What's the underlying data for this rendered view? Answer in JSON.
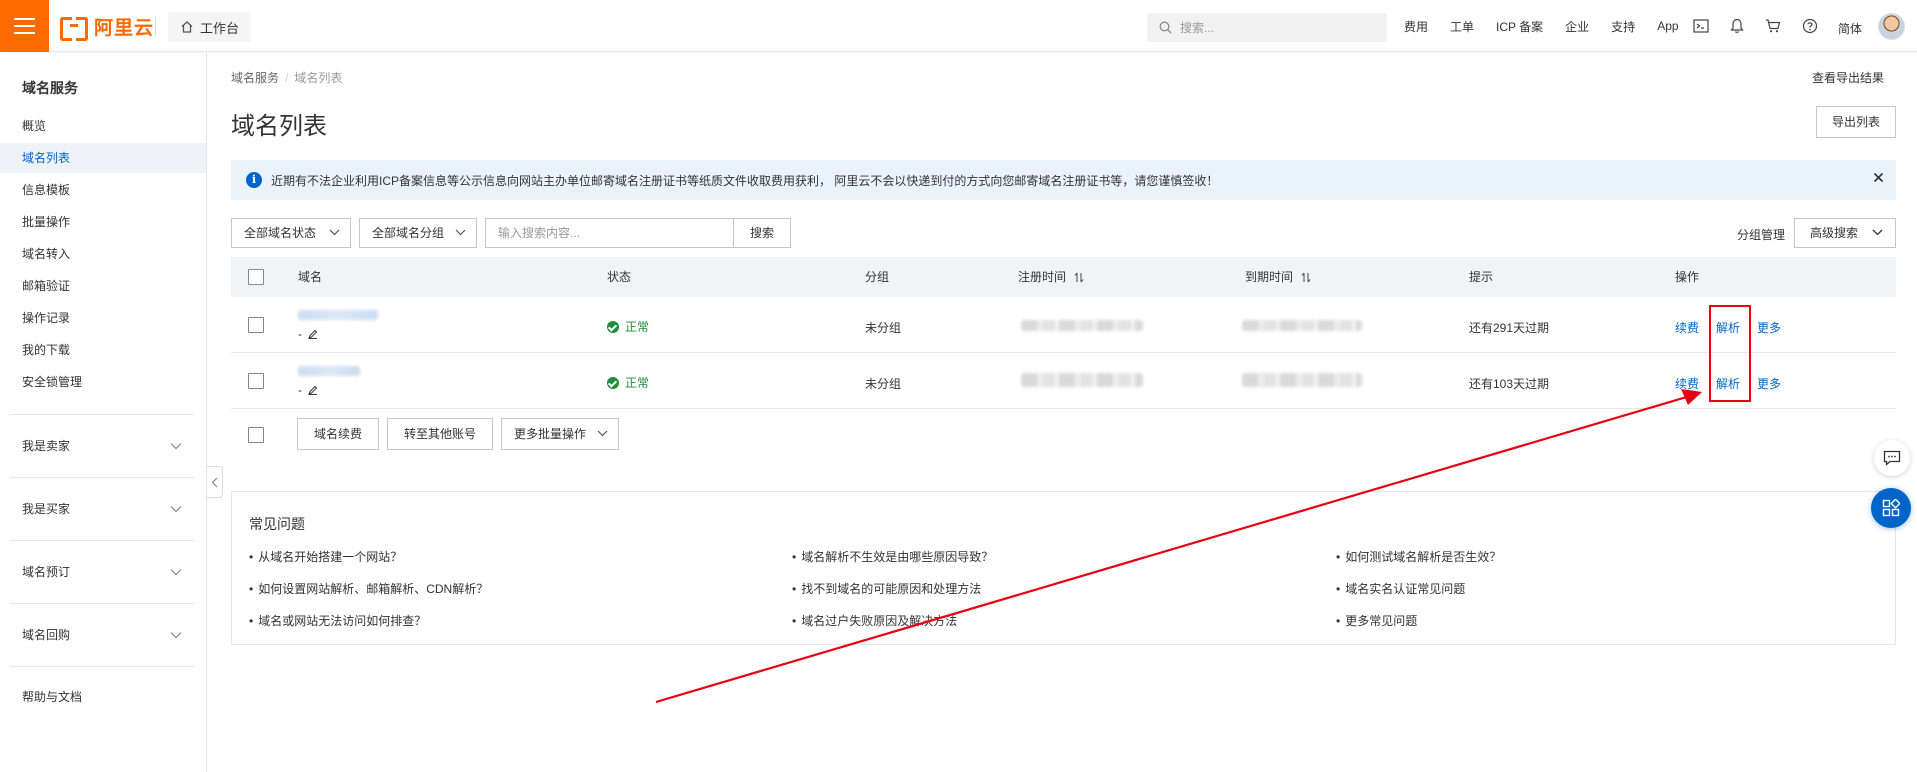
{
  "topbar": {
    "brand": "阿里云",
    "workbench": "工作台",
    "search_placeholder": "搜索...",
    "nav": [
      "费用",
      "工单",
      "ICP 备案",
      "企业",
      "支持",
      "App"
    ],
    "language": "简体"
  },
  "sidebar": {
    "title": "域名服务",
    "items": [
      {
        "label": "概览",
        "active": false
      },
      {
        "label": "域名列表",
        "active": true
      },
      {
        "label": "信息模板",
        "active": false
      },
      {
        "label": "批量操作",
        "active": false
      },
      {
        "label": "域名转入",
        "active": false
      },
      {
        "label": "邮箱验证",
        "active": false
      },
      {
        "label": "操作记录",
        "active": false
      },
      {
        "label": "我的下载",
        "active": false
      },
      {
        "label": "安全锁管理",
        "active": false
      }
    ],
    "groups": [
      "我是卖家",
      "我是买家",
      "域名预订",
      "域名回购"
    ],
    "help": "帮助与文档"
  },
  "breadcrumb": {
    "root": "域名服务",
    "current": "域名列表"
  },
  "page": {
    "title": "域名列表",
    "export_results": "查看导出结果",
    "export_list": "导出列表"
  },
  "notice": {
    "text": "近期有不法企业利用ICP备案信息等公示信息向网站主办单位邮寄域名注册证书等纸质文件收取费用获利， 阿里云不会以快递到付的方式向您邮寄域名注册证书等，请您谨慎签收！"
  },
  "filters": {
    "status": "全部域名状态",
    "group": "全部域名分组",
    "keyword_placeholder": "输入搜索内容...",
    "search": "搜索",
    "group_mgmt": "分组管理",
    "advanced": "高级搜索"
  },
  "table": {
    "headers": {
      "domain": "域名",
      "status": "状态",
      "group": "分组",
      "reg_time": "注册时间",
      "exp_time": "到期时间",
      "hint": "提示",
      "ops": "操作"
    },
    "rows": [
      {
        "domain": "",
        "remark": "-",
        "status": "正常",
        "group": "未分组",
        "reg_time": "",
        "exp_time": "",
        "hint": "还有291天过期"
      },
      {
        "domain": "",
        "remark": "-",
        "status": "正常",
        "group": "未分组",
        "reg_time": "",
        "exp_time": "",
        "hint": "还有103天过期"
      }
    ],
    "ops": {
      "renew": "续费",
      "resolve": "解析",
      "more": "更多"
    }
  },
  "bulk": {
    "renew": "域名续费",
    "transfer": "转至其他账号",
    "more": "更多批量操作"
  },
  "faq": {
    "title": "常见问题",
    "items": [
      "从域名开始搭建一个网站？",
      "域名解析不生效是由哪些原因导致？",
      "如何测试域名解析是否生效？",
      "如何设置网站解析、邮箱解析、CDN解析？",
      "找不到域名的可能原因和处理方法",
      "域名实名认证常见问题",
      "域名或网站无法访问如何排查？",
      "域名过户失败原因及解决方法",
      "更多常见问题"
    ]
  },
  "colors": {
    "brand": "#ff6a00",
    "link": "#0064c8",
    "success": "#1e8e3e",
    "annotation": "#e60012"
  }
}
